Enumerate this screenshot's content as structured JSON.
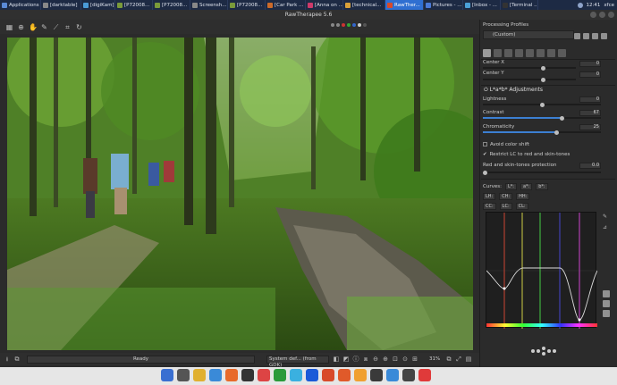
{
  "taskbar": {
    "items": [
      {
        "label": "Applications",
        "color": "#5a8ad8"
      },
      {
        "label": "[darktable]",
        "color": "#888888"
      },
      {
        "label": "[digiKam]",
        "color": "#4a9ad8"
      },
      {
        "label": "[P72008...",
        "color": "#7a9a3a"
      },
      {
        "label": "[P72008...",
        "color": "#7a9a3a"
      },
      {
        "label": "Screensh...",
        "color": "#888888"
      },
      {
        "label": "[P72008...",
        "color": "#7a9a3a"
      },
      {
        "label": "[Car Park ...",
        "color": "#cc6a2a"
      },
      {
        "label": "[Anna on ...",
        "color": "#cc3a6a"
      },
      {
        "label": "[technical...",
        "color": "#d8a03a"
      },
      {
        "label": "RawTher...",
        "color": "#d84a2a",
        "active": true
      },
      {
        "label": "Pictures - ...",
        "color": "#4a7ad8"
      },
      {
        "label": "[Inbox - ...",
        "color": "#4aa0d8"
      },
      {
        "label": "[Terminal ...",
        "color": "#333333"
      }
    ],
    "clock": "12:41",
    "user": "xfce"
  },
  "title": "RawTherapee 5.6",
  "statusbar": {
    "progress_text": "Ready",
    "profile": "System def... (from GDK)",
    "zoom": "31%"
  },
  "panel": {
    "header": "Processing Profiles",
    "profile_value": "(Custom)",
    "center_x": {
      "label": "Center X",
      "value": "0"
    },
    "center_y": {
      "label": "Center Y",
      "value": "0"
    },
    "lab_title": "L*a*b* Adjustments",
    "lightness": {
      "label": "Lightness",
      "value": "0",
      "fraction": 0.5
    },
    "contrast": {
      "label": "Contrast",
      "value": "67",
      "fraction": 0.667
    },
    "chromaticity": {
      "label": "Chromaticity",
      "value": "25",
      "fraction": 0.625
    },
    "avoid_color_shift": {
      "label": "Avoid color shift",
      "checked": false
    },
    "restrict_lc": {
      "label": "Restrict LC to red and skin-tones",
      "checked": true
    },
    "red_skin_protection": {
      "label": "Red and skin-tones protection",
      "value": "0.0"
    },
    "curves_label": "Curves:",
    "curve_row1": [
      "L*:",
      "a*:",
      "b*:"
    ],
    "curve_row2": [
      "LH:",
      "CH:",
      "HH:"
    ],
    "curve_row3": [
      "CC:",
      "LC:",
      "CL:"
    ]
  },
  "colors": {
    "accent": "#3c7fd2",
    "taskbar": "#1d2a44"
  }
}
